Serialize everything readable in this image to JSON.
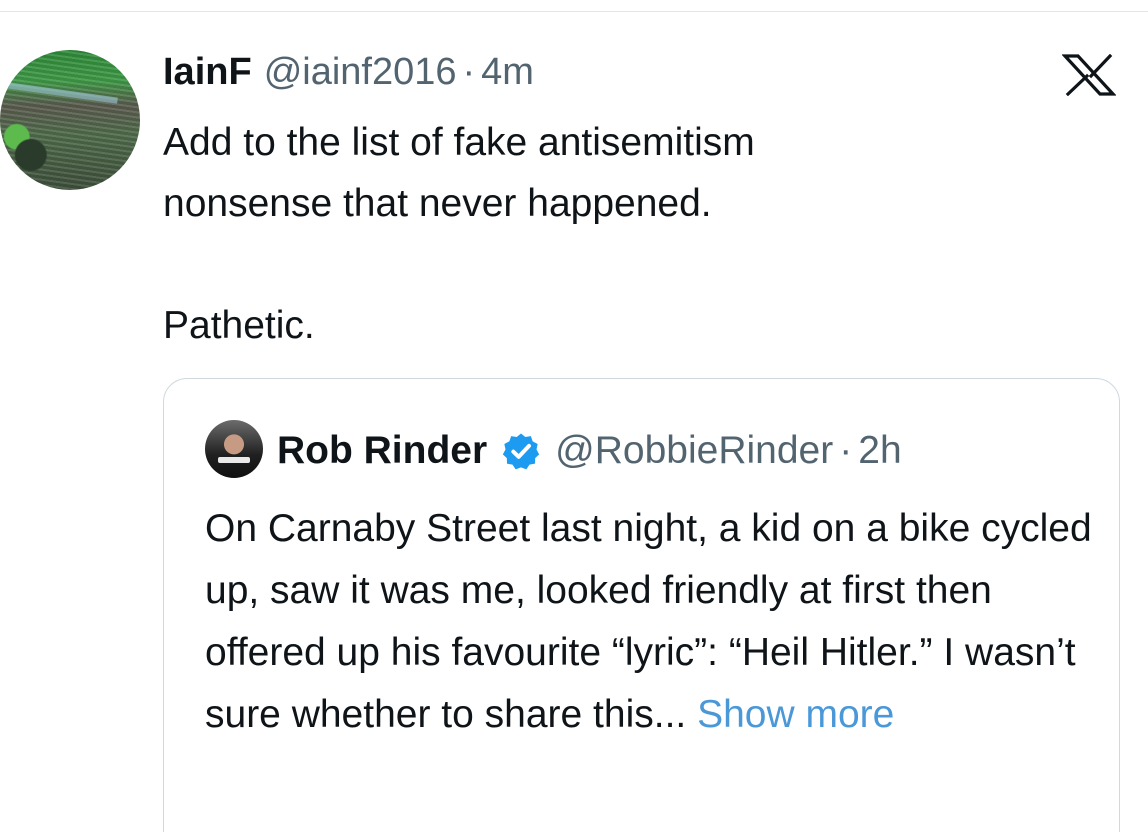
{
  "post": {
    "display_name": "IainF",
    "handle": "@iainf2016",
    "separator": "·",
    "time": "4m",
    "text": "Add to the list of fake antisemitism\nnonsense that never happened.\n\nPathetic.",
    "avatar_icon": "crowd-photo-avatar"
  },
  "close_icon": "x-logo-icon",
  "quoted": {
    "display_name": "Rob Rinder",
    "verified_icon": "verified-badge-icon",
    "verified_color": "#1d9bf0",
    "handle": "@RobbieRinder",
    "separator": "·",
    "time": "2h",
    "text": "On Carnaby Street last night, a kid on a bike cycled up, saw it was me, looked friendly at first then offered up his favourite “lyric”: “Heil Hitler.” I wasn’t sure whether to share this...",
    "show_more": "Show more",
    "show_more_color": "#4a98d8"
  }
}
